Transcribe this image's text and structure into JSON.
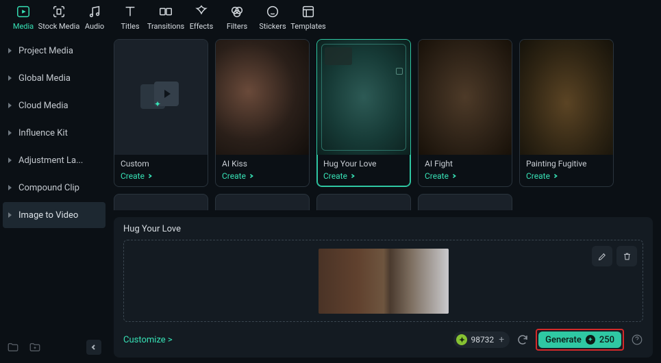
{
  "toolbar": [
    {
      "id": "media",
      "label": "Media",
      "active": true
    },
    {
      "id": "stock-media",
      "label": "Stock Media",
      "active": false
    },
    {
      "id": "audio",
      "label": "Audio",
      "active": false
    },
    {
      "id": "titles",
      "label": "Titles",
      "active": false
    },
    {
      "id": "transitions",
      "label": "Transitions",
      "active": false
    },
    {
      "id": "effects",
      "label": "Effects",
      "active": false
    },
    {
      "id": "filters",
      "label": "Filters",
      "active": false
    },
    {
      "id": "stickers",
      "label": "Stickers",
      "active": false
    },
    {
      "id": "templates",
      "label": "Templates",
      "active": false
    }
  ],
  "sidebar": [
    {
      "id": "project-media",
      "label": "Project Media",
      "active": false
    },
    {
      "id": "global-media",
      "label": "Global Media",
      "active": false
    },
    {
      "id": "cloud-media",
      "label": "Cloud Media",
      "active": false
    },
    {
      "id": "influence-kit",
      "label": "Influence Kit",
      "active": false
    },
    {
      "id": "adjustment-layer",
      "label": "Adjustment La...",
      "active": false
    },
    {
      "id": "compound-clip",
      "label": "Compound Clip",
      "active": false
    },
    {
      "id": "image-to-video",
      "label": "Image to Video",
      "active": true
    }
  ],
  "cards": [
    {
      "id": "custom",
      "title": "Custom",
      "create": "Create",
      "selected": false
    },
    {
      "id": "ai-kiss",
      "title": "AI Kiss",
      "create": "Create",
      "selected": false
    },
    {
      "id": "hug",
      "title": "Hug Your Love",
      "create": "Create",
      "selected": true
    },
    {
      "id": "ai-fight",
      "title": "AI Fight",
      "create": "Create",
      "selected": false
    },
    {
      "id": "painting",
      "title": "Painting Fugitive",
      "create": "Create",
      "selected": false
    }
  ],
  "editor": {
    "title": "Hug Your Love",
    "customize": "Customize >",
    "credits": "98732",
    "generate_label": "Generate",
    "generate_cost": "250"
  }
}
